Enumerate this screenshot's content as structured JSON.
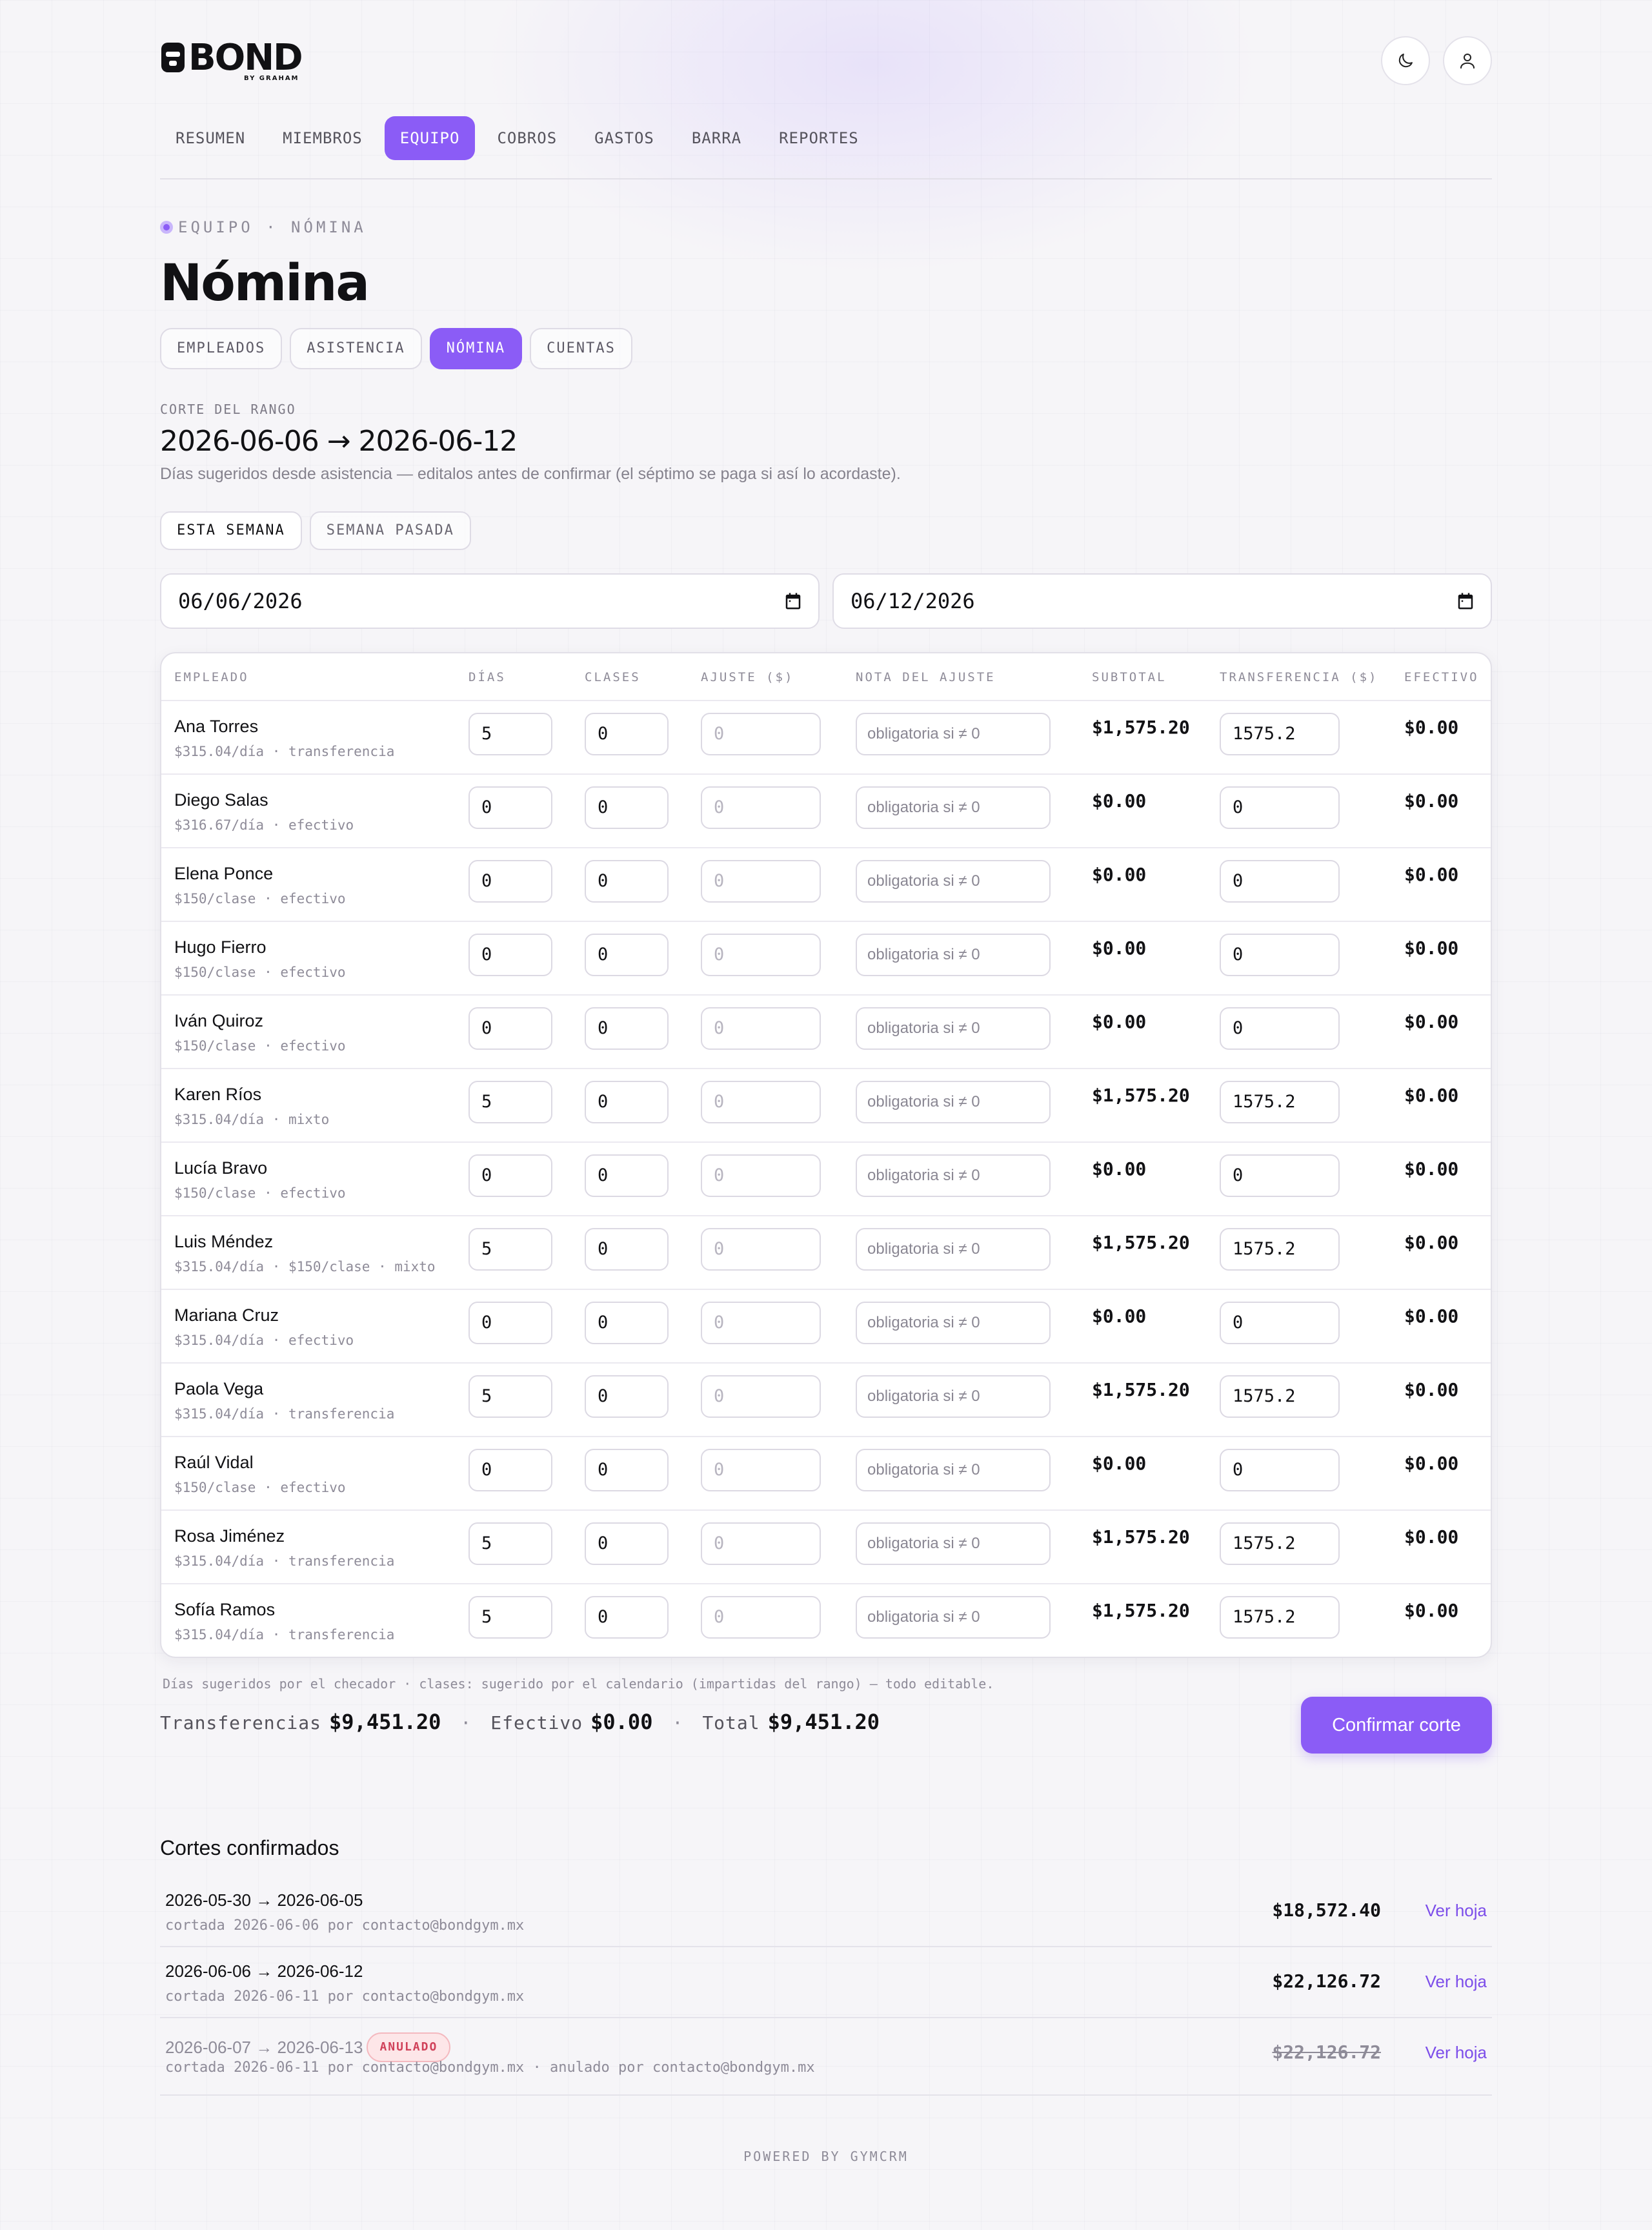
{
  "brand": {
    "name": "BOND",
    "sub": "BY GRAHAM"
  },
  "nav": [
    {
      "label": "RESUMEN"
    },
    {
      "label": "MIEMBROS"
    },
    {
      "label": "EQUIPO",
      "active": true
    },
    {
      "label": "COBROS"
    },
    {
      "label": "GASTOS"
    },
    {
      "label": "BARRA"
    },
    {
      "label": "REPORTES"
    }
  ],
  "header": {
    "eyebrow": "EQUIPO · NÓMINA",
    "title": "Nómina"
  },
  "subtabs": [
    {
      "label": "EMPLEADOS"
    },
    {
      "label": "ASISTENCIA"
    },
    {
      "label": "NÓMINA",
      "active": true
    },
    {
      "label": "CUENTAS"
    }
  ],
  "range": {
    "label": "CORTE DEL RANGO",
    "value": "2026-06-06 → 2026-06-12",
    "hint": "Días sugeridos desde asistencia — editalos antes de confirmar (el séptimo se paga si así lo acordaste).",
    "quick": [
      {
        "label": "ESTA SEMANA",
        "active": true
      },
      {
        "label": "SEMANA PASADA"
      }
    ],
    "from": "06/06/2026",
    "to": "06/12/2026"
  },
  "table": {
    "headers": [
      "EMPLEADO",
      "DÍAS",
      "CLASES",
      "AJUSTE ($)",
      "NOTA DEL AJUSTE",
      "SUBTOTAL",
      "TRANSFERENCIA ($)",
      "EFECTIVO"
    ],
    "note_placeholder": "obligatoria si ≠ 0",
    "adjust_placeholder": "0",
    "rows": [
      {
        "name": "Ana Torres",
        "meta": "$315.04/día · transferencia",
        "dias": "5",
        "clases": "0",
        "subtotal": "$1,575.20",
        "transfer": "1575.2",
        "efectivo": "$0.00"
      },
      {
        "name": "Diego Salas",
        "meta": "$316.67/día · efectivo",
        "dias": "0",
        "clases": "0",
        "subtotal": "$0.00",
        "transfer": "0",
        "efectivo": "$0.00"
      },
      {
        "name": "Elena Ponce",
        "meta": "$150/clase · efectivo",
        "dias": "0",
        "clases": "0",
        "subtotal": "$0.00",
        "transfer": "0",
        "efectivo": "$0.00"
      },
      {
        "name": "Hugo Fierro",
        "meta": "$150/clase · efectivo",
        "dias": "0",
        "clases": "0",
        "subtotal": "$0.00",
        "transfer": "0",
        "efectivo": "$0.00"
      },
      {
        "name": "Iván Quiroz",
        "meta": "$150/clase · efectivo",
        "dias": "0",
        "clases": "0",
        "subtotal": "$0.00",
        "transfer": "0",
        "efectivo": "$0.00"
      },
      {
        "name": "Karen Ríos",
        "meta": "$315.04/día · mixto",
        "dias": "5",
        "clases": "0",
        "subtotal": "$1,575.20",
        "transfer": "1575.2",
        "efectivo": "$0.00"
      },
      {
        "name": "Lucía Bravo",
        "meta": "$150/clase · efectivo",
        "dias": "0",
        "clases": "0",
        "subtotal": "$0.00",
        "transfer": "0",
        "efectivo": "$0.00"
      },
      {
        "name": "Luis Méndez",
        "meta": "$315.04/día · $150/clase · mixto",
        "dias": "5",
        "clases": "0",
        "subtotal": "$1,575.20",
        "transfer": "1575.2",
        "efectivo": "$0.00"
      },
      {
        "name": "Mariana Cruz",
        "meta": "$315.04/día · efectivo",
        "dias": "0",
        "clases": "0",
        "subtotal": "$0.00",
        "transfer": "0",
        "efectivo": "$0.00"
      },
      {
        "name": "Paola Vega",
        "meta": "$315.04/día · transferencia",
        "dias": "5",
        "clases": "0",
        "subtotal": "$1,575.20",
        "transfer": "1575.2",
        "efectivo": "$0.00"
      },
      {
        "name": "Raúl Vidal",
        "meta": "$150/clase · efectivo",
        "dias": "0",
        "clases": "0",
        "subtotal": "$0.00",
        "transfer": "0",
        "efectivo": "$0.00"
      },
      {
        "name": "Rosa Jiménez",
        "meta": "$315.04/día · transferencia",
        "dias": "5",
        "clases": "0",
        "subtotal": "$1,575.20",
        "transfer": "1575.2",
        "efectivo": "$0.00"
      },
      {
        "name": "Sofía Ramos",
        "meta": "$315.04/día · transferencia",
        "dias": "5",
        "clases": "0",
        "subtotal": "$1,575.20",
        "transfer": "1575.2",
        "efectivo": "$0.00"
      }
    ]
  },
  "footnote": "Días sugeridos por el checador · clases: sugerido por el calendario (impartidas del rango) — todo editable.",
  "totals": {
    "transfer_label": "Transferencias",
    "transfer": "$9,451.20",
    "cash_label": "Efectivo",
    "cash": "$0.00",
    "total_label": "Total",
    "total": "$9,451.20",
    "sep": "·"
  },
  "confirm_label": "Confirmar corte",
  "cuts": {
    "title": "Cortes confirmados",
    "link_label": "Ver hoja",
    "items": [
      {
        "range": "2026-05-30 → 2026-06-05",
        "meta": "cortada 2026-06-06 por contacto@bondgym.mx",
        "amount": "$18,572.40"
      },
      {
        "range": "2026-06-06 → 2026-06-12",
        "meta": "cortada 2026-06-11 por contacto@bondgym.mx",
        "amount": "$22,126.72"
      },
      {
        "range": "2026-06-07 → 2026-06-13",
        "badge": "ANULADO",
        "meta": "cortada 2026-06-11 por contacto@bondgym.mx · anulado por contacto@bondgym.mx",
        "amount": "$22,126.72",
        "void": true
      }
    ]
  },
  "powered": "POWERED BY GYMCRM",
  "colors": {
    "accent": "#8b5cf6",
    "link": "#7c4dea",
    "void": "#d0425a"
  }
}
